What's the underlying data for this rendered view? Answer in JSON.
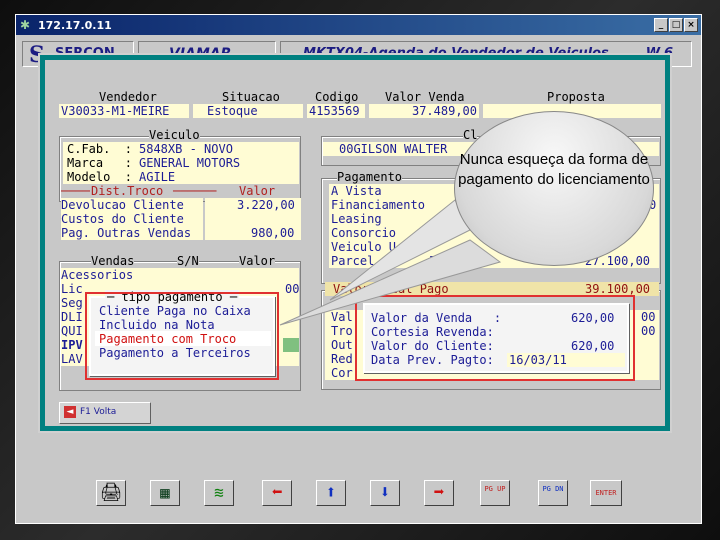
{
  "window": {
    "title": "172.17.0.11",
    "buttons": [
      "_",
      "□",
      "×"
    ]
  },
  "header": {
    "logo": "S",
    "company": "SERCON",
    "client": "VIAMAR",
    "screen": "MKTX04-Agenda do Vendedor de Veiculos",
    "version": "W.6"
  },
  "main": {
    "row1": {
      "vendedor_label": "Vendedor",
      "situacao_label": "Situacao",
      "codigo_label": "Codigo",
      "valor_venda_label": "Valor Venda",
      "proposta_label": "Proposta",
      "vendedor": "V30033-M1-MEIRE",
      "situacao": "Estoque",
      "codigo": "4153569",
      "valor_venda": "37.489,00"
    },
    "veiculo": {
      "title": "Veiculo",
      "rows": [
        {
          "label": "C.Fab.  :",
          "value": "5848XB - NOVO"
        },
        {
          "label": "Marca   :",
          "value": "GENERAL MOTORS"
        },
        {
          "label": "Modelo  :",
          "value": "AGILE"
        }
      ]
    },
    "dist_troco": {
      "title": "Dist.Troco",
      "valor_label": "Valor",
      "rows": [
        {
          "label": "Devolucao Cliente",
          "value": "3.220,00"
        },
        {
          "label": "Custos do Cliente",
          "value": ""
        },
        {
          "label": "Pag. Outras Vendas",
          "value": "980,00"
        }
      ]
    },
    "cliente": {
      "title": "Cl",
      "name": "00GILSON WALTER"
    },
    "pagamento": {
      "title": "Pagamento",
      "rows": [
        "A Vista",
        "Financiamento",
        "Leasing",
        "Consorcio",
        "Veiculo U",
        "Parcel"
      ],
      "parcel_count": "5",
      "parcel_value": "27.100,00",
      "financ_partial": "0"
    },
    "vendas": {
      "title": "Vendas",
      "sn_label": "S/N",
      "valor_label": "Valor",
      "rows": [
        "Acessorios",
        "Lic",
        "Seg",
        "DLI",
        "QUI",
        "IPV",
        "LAV"
      ],
      "lic_value": "00"
    },
    "tipo_pagamento": {
      "title": "tipo pagamento",
      "options": [
        "Cliente Paga no Caixa",
        "Incluido na Nota",
        "Pagamento com Troco",
        "Pagamento a Terceiros"
      ],
      "selected": 2
    },
    "valor_total": {
      "label": "Valor Total Pago",
      "value": "39.100,00"
    },
    "totals_left": [
      "Val",
      "Tro",
      "Out",
      "Red",
      "Cor"
    ],
    "totals_right": [
      "00",
      "00"
    ],
    "detalhe": {
      "rows": [
        {
          "label": "Valor da Venda   :",
          "value": "620,00"
        },
        {
          "label": "Cortesia Revenda:",
          "value": ""
        },
        {
          "label": "Valor do Cliente:",
          "value": "620,00"
        },
        {
          "label": "Data Prev. Pagto:",
          "value": "16/03/11"
        }
      ]
    },
    "volta_button": "F1 Volta"
  },
  "callout": {
    "text": "Nunca esqueça da forma de pagamento do licenciamento"
  },
  "toolbar": {
    "icons": [
      "printer-icon",
      "calculator-icon",
      "money-icon",
      "arrow-left-icon",
      "arrow-up-icon",
      "arrow-down-icon",
      "arrow-right-icon",
      "page-up-icon",
      "page-down-icon",
      "enter-icon"
    ],
    "pgup": "PG UP",
    "pgdn": "PG DN",
    "enter": "ENTER"
  },
  "colors": {
    "titlebar": "#0a246a",
    "teal": "#008080",
    "field": "#fffcd4",
    "highlight_red": "#e03030",
    "text_blue": "#1c1c96"
  }
}
